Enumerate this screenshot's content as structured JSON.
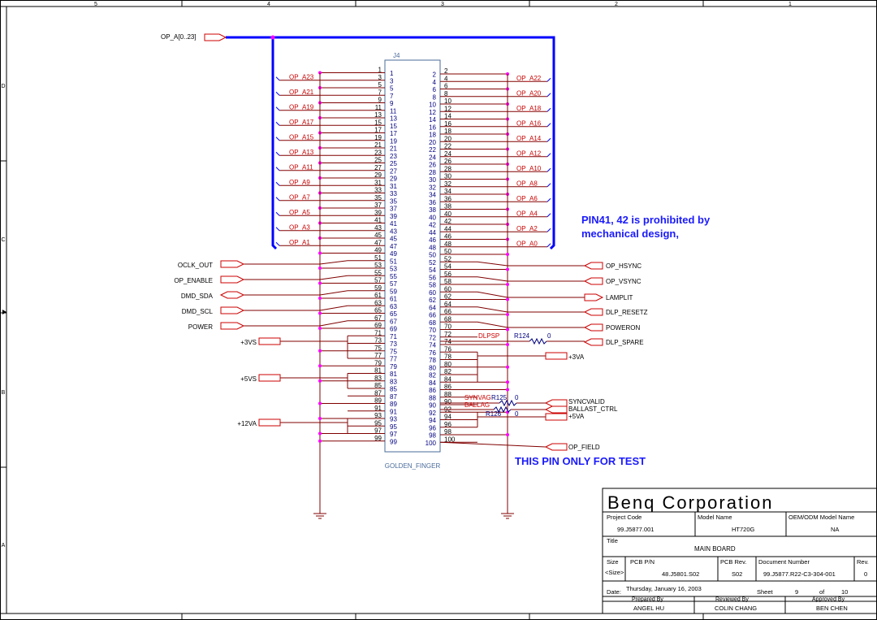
{
  "border": {
    "col_numbers": [
      "5",
      "4",
      "3",
      "2",
      "1"
    ],
    "row_letters": [
      "D",
      "C",
      "B",
      "A"
    ]
  },
  "bus": {
    "label": "OP_A[0..23]"
  },
  "connector": {
    "refdes": "J4",
    "footprint": "GOLDEN_FINGER",
    "left_pins": [
      "1",
      "3",
      "5",
      "7",
      "9",
      "11",
      "13",
      "15",
      "17",
      "19",
      "21",
      "23",
      "25",
      "27",
      "29",
      "31",
      "33",
      "35",
      "37",
      "39",
      "41",
      "43",
      "45",
      "47",
      "49",
      "51",
      "53",
      "55",
      "57",
      "59",
      "61",
      "63",
      "65",
      "67",
      "69",
      "71",
      "73",
      "75",
      "77",
      "79",
      "81",
      "83",
      "85",
      "87",
      "89",
      "91",
      "93",
      "95",
      "97",
      "99"
    ],
    "right_pins": [
      "2",
      "4",
      "6",
      "8",
      "10",
      "12",
      "14",
      "16",
      "18",
      "20",
      "22",
      "24",
      "26",
      "28",
      "30",
      "32",
      "34",
      "36",
      "38",
      "40",
      "42",
      "44",
      "46",
      "48",
      "50",
      "52",
      "54",
      "56",
      "58",
      "60",
      "62",
      "64",
      "66",
      "68",
      "70",
      "72",
      "74",
      "76",
      "78",
      "80",
      "82",
      "84",
      "86",
      "88",
      "90",
      "92",
      "94",
      "96",
      "98",
      "100"
    ]
  },
  "left_bus_signals": [
    "OP_A23",
    "OP_A21",
    "OP_A19",
    "OP_A17",
    "OP_A15",
    "OP_A13",
    "OP_A11",
    "OP_A9",
    "OP_A7",
    "OP_A5",
    "OP_A3",
    "OP_A1"
  ],
  "right_bus_signals": [
    "OP_A22",
    "OP_A20",
    "OP_A18",
    "OP_A16",
    "OP_A14",
    "OP_A12",
    "OP_A10",
    "OP_A8",
    "OP_A6",
    "OP_A4",
    "OP_A2",
    "OP_A0"
  ],
  "left_ports": [
    "OCLK_OUT",
    "OP_ENABLE",
    "DMD_SDA",
    "DMD_SCL",
    "POWER"
  ],
  "right_ports": [
    "OP_HSYNC",
    "OP_VSYNC",
    "LAMPLIT",
    "DLP_RESETZ",
    "POWERON",
    "DLP_SPARE"
  ],
  "power_ports": [
    "+3VS",
    "+5VS",
    "+12VA"
  ],
  "right_power": [
    "+3VA",
    "+5VA"
  ],
  "extra_ports": [
    "SYNCVALID",
    "BALLAST_CTRL",
    "OP_FIELD"
  ],
  "resistors": {
    "r124": {
      "ref": "R124",
      "value": "0",
      "net": "DLPSP"
    },
    "r125": {
      "ref": "R125",
      "value": "0",
      "net": "SYNVAG"
    },
    "r126": {
      "ref": "R126",
      "value": "0",
      "net": "BALLAG"
    }
  },
  "notes": {
    "line1": "PIN41, 42 is prohibited by",
    "line2": "mechanical design,",
    "test": "THIS PIN ONLY FOR TEST"
  },
  "title_block": {
    "company": "Benq Corporation",
    "project_code_label": "Project Code",
    "project_code": "99.J5877.001",
    "model_name_label": "Model Name",
    "model_name": "HT720G",
    "oem_label": "OEM/ODM Model Name",
    "oem": "NA",
    "title_label": "Title",
    "title": "MAIN BOARD",
    "size_label": "Size",
    "size": "<Size>",
    "pcb_pn_label": "PCB P/N",
    "pcb_pn": "48.J5801.S02",
    "pcb_rev_label": "PCB Rev.",
    "pcb_rev": "S02",
    "doc_label": "Document Number",
    "doc": "99.J5877.R22-C3-304-001",
    "rev_label": "Rev.",
    "rev": "0",
    "date_label": "Date:",
    "date": "Thursday, January 16, 2003",
    "sheet_label": "Sheet",
    "sheet": "9",
    "of_label": "of",
    "of": "10",
    "prepared_label": "Prepared By",
    "prepared": "ANGEL HU",
    "reviewed_label": "Reviewed By",
    "reviewed": "COLIN CHANG",
    "approved_label": "Approved By",
    "approved": "BEN CHEN"
  },
  "colors": {
    "bus": "#0000ff",
    "wire": "#800000",
    "junction": "#ff00ff",
    "connector": "#4a6b9a",
    "net_text": "#cc0000",
    "pin_text": "#000080",
    "note_text": "#1a1aff"
  }
}
